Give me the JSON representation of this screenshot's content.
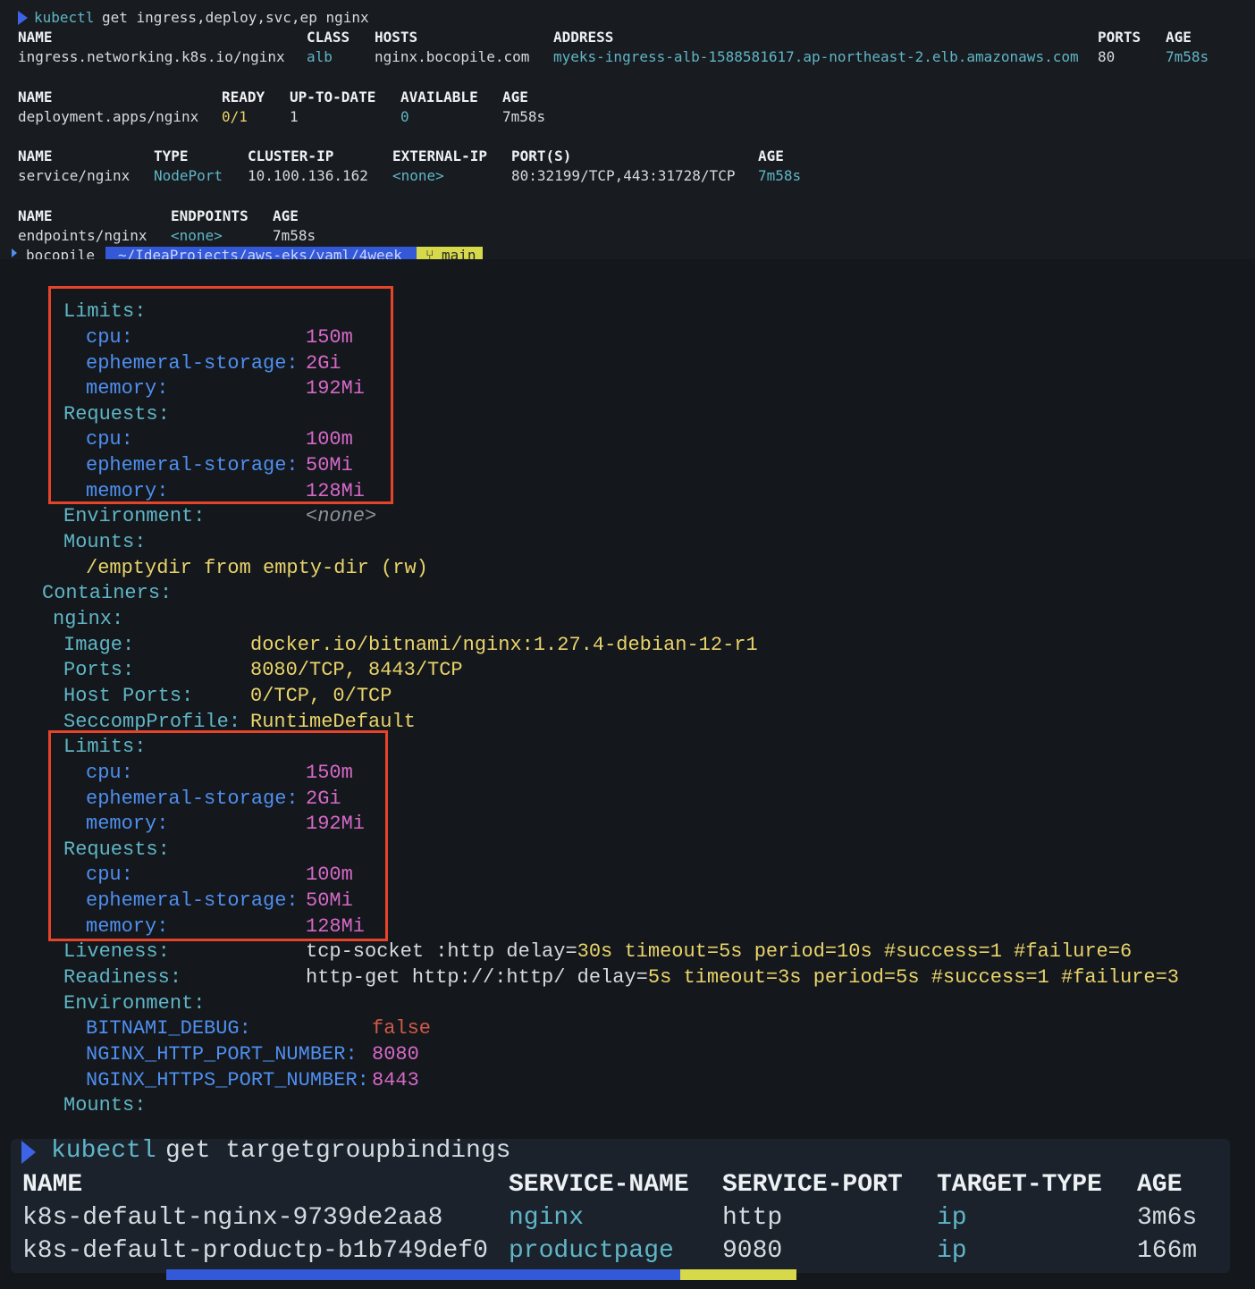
{
  "top": {
    "cmd": "kubectl",
    "args": "get ingress,deploy,svc,ep nginx",
    "ingress": {
      "headers": [
        "NAME",
        "CLASS",
        "HOSTS",
        "ADDRESS",
        "PORTS",
        "AGE"
      ],
      "row": [
        "ingress.networking.k8s.io/nginx",
        "alb",
        "nginx.bocopile.com",
        "myeks-ingress-alb-1588581617.ap-northeast-2.elb.amazonaws.com",
        "80",
        "7m58s"
      ]
    },
    "deployment": {
      "headers": [
        "NAME",
        "READY",
        "UP-TO-DATE",
        "AVAILABLE",
        "AGE"
      ],
      "row": [
        "deployment.apps/nginx",
        "0/1",
        "1",
        "0",
        "7m58s"
      ]
    },
    "service": {
      "headers": [
        "NAME",
        "TYPE",
        "CLUSTER-IP",
        "EXTERNAL-IP",
        "PORT(S)",
        "AGE"
      ],
      "row": [
        "service/nginx",
        "NodePort",
        "10.100.136.162",
        "<none>",
        "80:32199/TCP,443:31728/TCP",
        "7m58s"
      ]
    },
    "endpoints": {
      "headers": [
        "NAME",
        "ENDPOINTS",
        "AGE"
      ],
      "row": [
        "endpoints/nginx",
        "<none>",
        "7m58s"
      ]
    },
    "statusline": {
      "user": "bocopile",
      "path": "~/IdeaProjects/aws-eks/yaml/4week",
      "branch": "main"
    }
  },
  "describe": {
    "limits1": {
      "label": "Limits:",
      "cpu_k": "cpu:",
      "cpu_v": "150m",
      "eph_k": "ephemeral-storage:",
      "eph_v": "2Gi",
      "mem_k": "memory:",
      "mem_v": "192Mi"
    },
    "requests1": {
      "label": "Requests:",
      "cpu_k": "cpu:",
      "cpu_v": "100m",
      "eph_k": "ephemeral-storage:",
      "eph_v": "50Mi",
      "mem_k": "memory:",
      "mem_v": "128Mi"
    },
    "environment1": {
      "label": "Environment:",
      "value": "<none>"
    },
    "mounts1": {
      "label": "Mounts:",
      "value": "/emptydir from empty-dir (rw)"
    },
    "containers": "Containers:",
    "container_name": "nginx:",
    "image": {
      "label": "Image:",
      "value": "docker.io/bitnami/nginx:1.27.4-debian-12-r1"
    },
    "ports": {
      "label": "Ports:",
      "value": "8080/TCP, 8443/TCP"
    },
    "host_ports": {
      "label": "Host Ports:",
      "value": "0/TCP, 0/TCP"
    },
    "seccomp": {
      "label": "SeccompProfile:",
      "value": "RuntimeDefault"
    },
    "limits2": {
      "label": "Limits:",
      "cpu_k": "cpu:",
      "cpu_v": "150m",
      "eph_k": "ephemeral-storage:",
      "eph_v": "2Gi",
      "mem_k": "memory:",
      "mem_v": "192Mi"
    },
    "requests2": {
      "label": "Requests:",
      "cpu_k": "cpu:",
      "cpu_v": "100m",
      "eph_k": "ephemeral-storage:",
      "eph_v": "50Mi",
      "mem_k": "memory:",
      "mem_v": "128Mi"
    },
    "liveness": {
      "label": "Liveness:",
      "p1": "tcp-socket :http delay=",
      "v1": "30s timeout=5s period=10s #success=1 #failure=6"
    },
    "readiness": {
      "label": "Readiness:",
      "p1": "http-get http://:http/ delay=",
      "v1": "5s timeout=3s period=5s #success=1 #failure=3"
    },
    "environment2": {
      "label": "Environment:",
      "vars": [
        {
          "k": "BITNAMI_DEBUG:",
          "v": "false"
        },
        {
          "k": "NGINX_HTTP_PORT_NUMBER:",
          "v": "8080"
        },
        {
          "k": "NGINX_HTTPS_PORT_NUMBER:",
          "v": "8443"
        }
      ]
    },
    "mounts2": {
      "label": "Mounts:"
    }
  },
  "tgb": {
    "cmd": "kubectl",
    "args": "get targetgroupbindings",
    "headers": [
      "NAME",
      "SERVICE-NAME",
      "SERVICE-PORT",
      "TARGET-TYPE",
      "AGE"
    ],
    "rows": [
      [
        "k8s-default-nginx-9739de2aa8",
        "nginx",
        "http",
        "ip",
        "3m6s"
      ],
      [
        "k8s-default-productp-b1b749def0",
        "productpage",
        "9080",
        "ip",
        "166m"
      ]
    ]
  },
  "colors": {
    "highlight_box": "#e5432a",
    "prompt": "#3d63e6",
    "path_bg": "#3358d8",
    "branch_bg": "#d6d94a"
  }
}
